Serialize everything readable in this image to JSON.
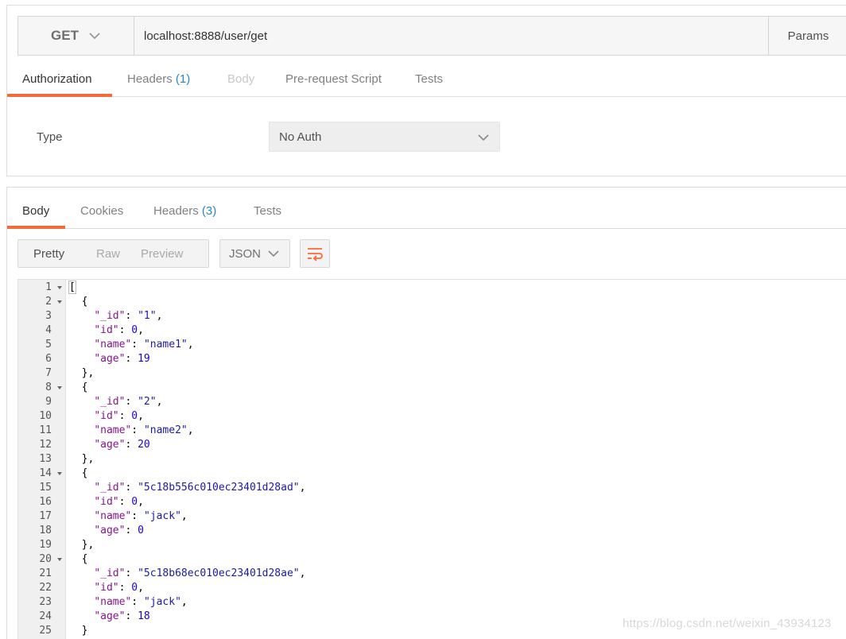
{
  "request": {
    "method": "GET",
    "url": "localhost:8888/user/get",
    "params_label": "Params",
    "tabs": [
      {
        "label": "Authorization",
        "count": "",
        "state": "active"
      },
      {
        "label": "Headers",
        "count": "(1)",
        "state": "normal"
      },
      {
        "label": "Body",
        "count": "",
        "state": "disabled"
      },
      {
        "label": "Pre-request Script",
        "count": "",
        "state": "normal"
      },
      {
        "label": "Tests",
        "count": "",
        "state": "normal"
      }
    ],
    "auth": {
      "type_label": "Type",
      "selected": "No Auth"
    }
  },
  "response": {
    "tabs": [
      {
        "label": "Body",
        "count": "",
        "state": "active"
      },
      {
        "label": "Cookies",
        "count": "",
        "state": "normal"
      },
      {
        "label": "Headers",
        "count": "(3)",
        "state": "normal"
      },
      {
        "label": "Tests",
        "count": "",
        "state": "normal"
      }
    ],
    "view_modes": [
      {
        "label": "Pretty",
        "active": true
      },
      {
        "label": "Raw",
        "active": false
      },
      {
        "label": "Preview",
        "active": false
      }
    ],
    "format": "JSON",
    "body_lines": [
      {
        "n": "1",
        "fold": true,
        "text": "["
      },
      {
        "n": "2",
        "fold": true,
        "text": "  {"
      },
      {
        "n": "3",
        "fold": false,
        "text": "    \"_id\": \"1\","
      },
      {
        "n": "4",
        "fold": false,
        "text": "    \"id\": 0,"
      },
      {
        "n": "5",
        "fold": false,
        "text": "    \"name\": \"name1\","
      },
      {
        "n": "6",
        "fold": false,
        "text": "    \"age\": 19"
      },
      {
        "n": "7",
        "fold": false,
        "text": "  },"
      },
      {
        "n": "8",
        "fold": true,
        "text": "  {"
      },
      {
        "n": "9",
        "fold": false,
        "text": "    \"_id\": \"2\","
      },
      {
        "n": "10",
        "fold": false,
        "text": "    \"id\": 0,"
      },
      {
        "n": "11",
        "fold": false,
        "text": "    \"name\": \"name2\","
      },
      {
        "n": "12",
        "fold": false,
        "text": "    \"age\": 20"
      },
      {
        "n": "13",
        "fold": false,
        "text": "  },"
      },
      {
        "n": "14",
        "fold": true,
        "text": "  {"
      },
      {
        "n": "15",
        "fold": false,
        "text": "    \"_id\": \"5c18b556c010ec23401d28ad\","
      },
      {
        "n": "16",
        "fold": false,
        "text": "    \"id\": 0,"
      },
      {
        "n": "17",
        "fold": false,
        "text": "    \"name\": \"jack\","
      },
      {
        "n": "18",
        "fold": false,
        "text": "    \"age\": 0"
      },
      {
        "n": "19",
        "fold": false,
        "text": "  },"
      },
      {
        "n": "20",
        "fold": true,
        "text": "  {"
      },
      {
        "n": "21",
        "fold": false,
        "text": "    \"_id\": \"5c18b68ec010ec23401d28ae\","
      },
      {
        "n": "22",
        "fold": false,
        "text": "    \"id\": 0,"
      },
      {
        "n": "23",
        "fold": false,
        "text": "    \"name\": \"jack\","
      },
      {
        "n": "24",
        "fold": false,
        "text": "    \"age\": 18"
      },
      {
        "n": "25",
        "fold": false,
        "text": "  }"
      }
    ]
  },
  "watermark": "https://blog.csdn.net/weixin_43934123",
  "colors": {
    "accent": "#f26b3a",
    "count": "#2a87c8",
    "json_key": "#881391",
    "json_string": "#1a1aa6",
    "json_number": "#1c00cf"
  }
}
